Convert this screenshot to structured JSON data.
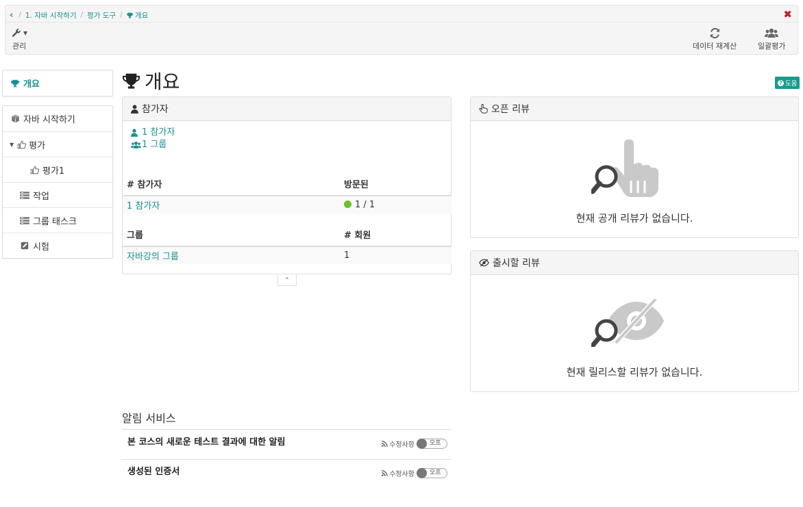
{
  "breadcrumb": {
    "items": [
      "1. 자바 시작하기",
      "평가 도구",
      "개요"
    ]
  },
  "toolbar": {
    "manage_label": "관리",
    "recalc_label": "데이터 재계산",
    "bulk_label": "일괄평가"
  },
  "sidebar": {
    "overview": "개요",
    "items": [
      {
        "label": "자바 시작하기",
        "icon": "cube-icon"
      },
      {
        "label": "평가",
        "icon": "thumbs-up-icon"
      },
      {
        "label": "평가1",
        "icon": "thumbs-up-icon"
      },
      {
        "label": "작업",
        "icon": "task-icon"
      },
      {
        "label": "그룹 태스크",
        "icon": "group-task-icon"
      },
      {
        "label": "시험",
        "icon": "test-icon"
      }
    ]
  },
  "page": {
    "title": "개요",
    "help": "도움"
  },
  "participants": {
    "header": "참가자",
    "link_participants": "1 참가자",
    "link_groups": "1 그룹",
    "table1": {
      "col1": "# 참가자",
      "col2": "방문된",
      "row": {
        "name": "1 참가자",
        "visited": "1 / 1"
      }
    },
    "table2": {
      "col1": "그룹",
      "col2": "# 회원",
      "row": {
        "name": "자바강의 그룹",
        "members": "1"
      }
    }
  },
  "open_reviews": {
    "header": "오픈 리뷰",
    "empty": "현재 공개 리뷰가 없습니다."
  },
  "release_reviews": {
    "header": "출시할 리뷰",
    "empty": "현재 릴리스할 리뷰가 없습니다."
  },
  "notifications": {
    "title": "알림 서비스",
    "rows": [
      {
        "text": "본 코스의 새로운 테스트 결과에 대한 알림",
        "changes": "수정사항",
        "toggle": "오프"
      },
      {
        "text": "생성된 인증서",
        "changes": "수정사항",
        "toggle": "오프"
      }
    ]
  },
  "colors": {
    "accent": "#1a8f91",
    "close": "#c9151e",
    "status_ok": "#6cbf2a",
    "help_bg": "#1a9a8c"
  }
}
